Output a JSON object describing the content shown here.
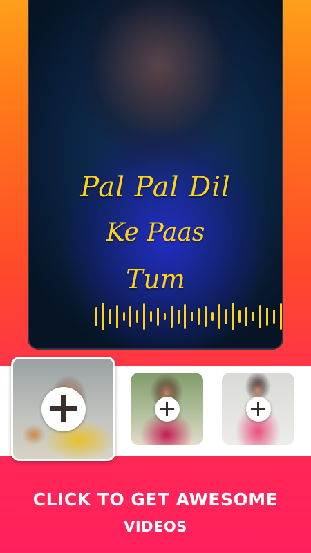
{
  "preview": {
    "title_line1": "Pal Pal Dil",
    "title_line2": "Ke Paas",
    "title_line3": "Tum",
    "waveform_icon": "audio-waveform-icon"
  },
  "thumbnails": [
    {
      "name": "thumbnail-main",
      "icon": "plus-icon",
      "selected": true
    },
    {
      "name": "thumbnail-two",
      "icon": "plus-icon",
      "selected": false
    },
    {
      "name": "thumbnail-three",
      "icon": "plus-icon",
      "selected": false
    }
  ],
  "cta": {
    "line1": "CLICK TO GET AWESOME",
    "line2": "VIDEOS"
  },
  "colors": {
    "accent_yellow": "#ffd21a",
    "gradient_top": "#ff9f1a",
    "gradient_bottom": "#ff1f5e"
  }
}
